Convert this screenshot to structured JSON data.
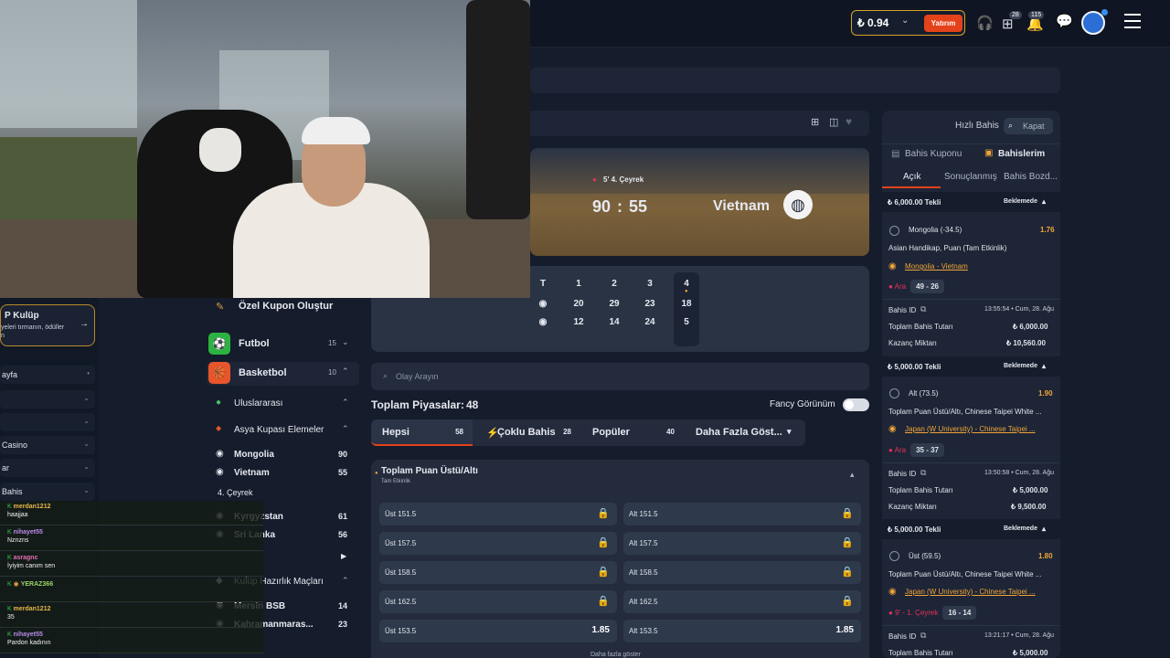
{
  "header": {
    "balance": "₺ 0.94",
    "deposit_label": "Yatırım",
    "gift_badge": "28",
    "notif_badge": "115"
  },
  "left_sidebar": {
    "vip_title": "P Kulüp",
    "vip_desc_1": "yeleri tırmanın, ödüller",
    "vip_desc_2": "n",
    "items": [
      {
        "label": "ayfa"
      },
      {
        "label": ""
      },
      {
        "label": ""
      },
      {
        "label": "Casino"
      },
      {
        "label": "ar"
      },
      {
        "label": "Bahis"
      }
    ]
  },
  "chat": [
    {
      "name": "merdan1212",
      "text": "haajjaa",
      "color": "#e6b84a"
    },
    {
      "name": "nihayet55",
      "text": "Nznzns",
      "color": "#b98be8"
    },
    {
      "name": "asragnc",
      "text": "İyiyim canım sen",
      "color": "#e36fb0"
    },
    {
      "name": "YERAZ366",
      "text": "",
      "color": "#9bd36a"
    },
    {
      "name": "merdan1212",
      "text": "35",
      "color": "#e6b84a"
    },
    {
      "name": "nihayet55",
      "text": "Pardon kadının",
      "color": "#b98be8"
    }
  ],
  "sports": {
    "custom_coupon": "Özel Kupon Oluştur",
    "football": {
      "label": "Futbol",
      "count": "15"
    },
    "basketball": {
      "label": "Basketbol",
      "count": "10"
    },
    "international": "Uluslararası",
    "asia_cup": "Asya Kupası Elemeler",
    "teams": [
      {
        "name": "Mongolia",
        "count": "90"
      },
      {
        "name": "Vietnam",
        "count": "55"
      }
    ],
    "live_label": "4. Çeyrek",
    "teams2": [
      {
        "name": "Kyrgyzstan",
        "count": "61"
      },
      {
        "name": "Sri Lanka",
        "count": "56"
      }
    ],
    "club_prep": "Kulüp Hazırlık Maçları",
    "teams3": [
      {
        "name": "Mersin BSB",
        "count": "14"
      },
      {
        "name": "Kahramanmaras...",
        "count": "23"
      }
    ]
  },
  "match": {
    "period": "5' 4. Çeyrek",
    "home_score": "90",
    "away_score": "55",
    "away_team": "Vietnam",
    "quarter_headers": [
      "T",
      "1",
      "2",
      "3",
      "4"
    ],
    "home_quarters": [
      "20",
      "29",
      "23",
      "18"
    ],
    "away_quarters": [
      "12",
      "14",
      "24",
      "5"
    ]
  },
  "markets": {
    "search_placeholder": "Olay Arayın",
    "total_label": "Toplam Piyasalar:",
    "total_count": "48",
    "fancy_label": "Fancy Görünüm",
    "tabs": [
      {
        "label": "Hepsi",
        "count": "58"
      },
      {
        "label": "Çoklu Bahis",
        "count": "28"
      },
      {
        "label": "Popüler",
        "count": "40"
      },
      {
        "label": "Daha Fazla Göst...",
        "count": ""
      }
    ],
    "market_title": "Toplam Puan Üstü/Altı",
    "market_sub": "Tam Etkinlik",
    "rows": [
      {
        "over": "Üst 151.5",
        "under": "Alt 151.5",
        "over_odd": "",
        "under_odd": ""
      },
      {
        "over": "Üst 157.5",
        "under": "Alt 157.5",
        "over_odd": "",
        "under_odd": ""
      },
      {
        "over": "Üst 158.5",
        "under": "Alt 158.5",
        "over_odd": "",
        "under_odd": ""
      },
      {
        "over": "Üst 162.5",
        "under": "Alt 162.5",
        "over_odd": "",
        "under_odd": ""
      },
      {
        "over": "Üst 153.5",
        "under": "Alt 153.5",
        "over_odd": "1.85",
        "under_odd": "1.85"
      }
    ],
    "more_label": "Daha fazla göster"
  },
  "coupon": {
    "quick_bet": "Hızlı Bahis",
    "close": "Kapat",
    "tab_coupon": "Bahis Kuponu",
    "tab_mybets": "Bahislerim",
    "sub_open": "Açık",
    "sub_settled": "Sonuçlanmış",
    "sub_bonus": "Bahis Bozd...",
    "bets": [
      {
        "header": "₺ 6,000.00 Tekli",
        "status": "Beklemede",
        "selection": "Mongolia (-34.5)",
        "odd": "1.76",
        "market": "Asian Handikap, Puan (Tam Etkinlik)",
        "event": "Mongolia - Vietnam",
        "live": "Ara",
        "score": "49 - 26",
        "bet_id_label": "Bahis ID",
        "time": "13:55:54 • Cum, 28. Ağu",
        "stake_label": "Toplam Bahis Tutarı",
        "stake": "₺ 6,000.00",
        "win_label": "Kazanç Miktarı",
        "win": "₺ 10,560.00"
      },
      {
        "header": "₺ 5,000.00 Tekli",
        "status": "Beklemede",
        "selection": "Alt (73.5)",
        "odd": "1.90",
        "market": "Toplam Puan Üstü/Altı, Chinese Taipei White ...",
        "event": "Japan (W University) - Chinese Taipei ...",
        "live": "Ara",
        "score": "35 - 37",
        "bet_id_label": "Bahis ID",
        "time": "13:50:58 • Cum, 28. Ağu",
        "stake_label": "Toplam Bahis Tutarı",
        "stake": "₺ 5,000.00",
        "win_label": "Kazanç Miktarı",
        "win": "₺ 9,500.00"
      },
      {
        "header": "₺ 5,000.00 Tekli",
        "status": "Beklemede",
        "selection": "Üst (59.5)",
        "odd": "1.80",
        "market": "Toplam Puan Üstü/Altı, Chinese Taipei White ...",
        "event": "Japan (W University) - Chinese Taipei ...",
        "live": "9' - 1. Çeyrek",
        "score": "16 - 14",
        "bet_id_label": "Bahis ID",
        "time": "13:21:17 • Cum, 28. Ağu",
        "stake_label": "Toplam Bahis Tutarı",
        "stake": "₺ 5,000.00"
      }
    ]
  }
}
